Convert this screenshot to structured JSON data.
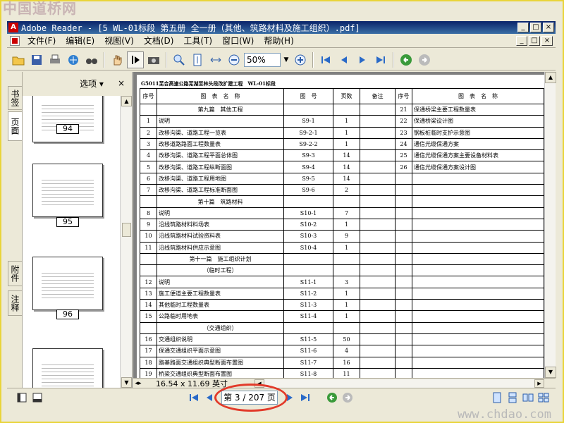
{
  "watermark_top": "中国道桥网",
  "watermark_bottom": "www.chdao.com",
  "window": {
    "title": "Adobe Reader - [5 WL-01标段 第五册 全一册（其他、筑路材料及施工组织）.pdf]",
    "min": "_",
    "max": "□",
    "close": "×"
  },
  "menu": [
    "文件(F)",
    "编辑(E)",
    "视图(V)",
    "文档(D)",
    "工具(T)",
    "窗口(W)",
    "帮助(H)"
  ],
  "toolbar": {
    "zoom": "50%"
  },
  "sidetabs": {
    "bookmarks": "书签",
    "pages": "页面",
    "attachments": "附件",
    "comments": "注释"
  },
  "navpanel": {
    "options": "选项 ▾",
    "close": "×",
    "thumbs": [
      "94",
      "95",
      "96"
    ]
  },
  "document": {
    "header": "G5011芜合高速公路芜湖至林头段改扩建工程　WL-01标段",
    "columns": [
      "序号",
      "图　表　名　称",
      "图　号",
      "页数",
      "备注"
    ],
    "columns_right": [
      "序号",
      "图　表　名　称"
    ],
    "rows": [
      {
        "no": "",
        "name": "第九篇　其他工程",
        "code": "",
        "pages": "",
        "section": true
      },
      {
        "no": "1",
        "name": "说明",
        "code": "S9-1",
        "pages": "1"
      },
      {
        "no": "2",
        "name": "改移沟渠、道路工程一览表",
        "code": "S9-2-1",
        "pages": "1"
      },
      {
        "no": "3",
        "name": "改移道路路面工程数量表",
        "code": "S9-2-2",
        "pages": "1"
      },
      {
        "no": "4",
        "name": "改移沟渠、道路工程平面总体图",
        "code": "S9-3",
        "pages": "14"
      },
      {
        "no": "5",
        "name": "改移沟渠、道路工程纵断面图",
        "code": "S9-4",
        "pages": "14"
      },
      {
        "no": "6",
        "name": "改移沟渠、道路工程用地图",
        "code": "S9-5",
        "pages": "14"
      },
      {
        "no": "7",
        "name": "改移沟渠、道路工程标准断面图",
        "code": "S9-6",
        "pages": "2"
      },
      {
        "no": "",
        "name": "第十篇　筑路材料",
        "code": "",
        "pages": "",
        "section": true
      },
      {
        "no": "8",
        "name": "说明",
        "code": "S10-1",
        "pages": "7"
      },
      {
        "no": "9",
        "name": "沿线筑路材料料场表",
        "code": "S10-2",
        "pages": "1"
      },
      {
        "no": "10",
        "name": "沿线筑路材料试验资料表",
        "code": "S10-3",
        "pages": "9"
      },
      {
        "no": "11",
        "name": "沿线筑路材料供应示意图",
        "code": "S10-4",
        "pages": "1"
      },
      {
        "no": "",
        "name": "第十一篇　施工组织计划",
        "code": "",
        "pages": "",
        "section": true
      },
      {
        "no": "",
        "name": "（临时工程）",
        "code": "",
        "pages": "",
        "section": true
      },
      {
        "no": "12",
        "name": "说明",
        "code": "S11-1",
        "pages": "3"
      },
      {
        "no": "13",
        "name": "施工便道主要工程数量表",
        "code": "S11-2",
        "pages": "1"
      },
      {
        "no": "14",
        "name": "其他临时工程数量表",
        "code": "S11-3",
        "pages": "1"
      },
      {
        "no": "15",
        "name": "公路临时用地表",
        "code": "S11-4",
        "pages": "1"
      },
      {
        "no": "",
        "name": "（交通组织）",
        "code": "",
        "pages": "",
        "section": true
      },
      {
        "no": "16",
        "name": "交通组织说明",
        "code": "S11-5",
        "pages": "50"
      },
      {
        "no": "17",
        "name": "保通交通组织平面示意图",
        "code": "S11-6",
        "pages": "4"
      },
      {
        "no": "18",
        "name": "路基路面交通组织典型断面布置图",
        "code": "S11-7",
        "pages": "16"
      },
      {
        "no": "19",
        "name": "桥梁交通组织典型断面布置图",
        "code": "S11-8",
        "pages": "11"
      }
    ],
    "rows_right": [
      {
        "no": "21",
        "name": "保通桥梁主要工程数量表"
      },
      {
        "no": "22",
        "name": "保通桥梁设计图"
      },
      {
        "no": "23",
        "name": "钢板桩临时支护示意图"
      },
      {
        "no": "24",
        "name": "通信光缆保通方案"
      },
      {
        "no": "25",
        "name": "通信光缆保通方案主要设备材料表"
      },
      {
        "no": "26",
        "name": "通信光缆保通方案设计图"
      }
    ]
  },
  "pagesize": "16.54 x 11.69 英寸",
  "status": {
    "page": "第 3 / 207 页"
  }
}
